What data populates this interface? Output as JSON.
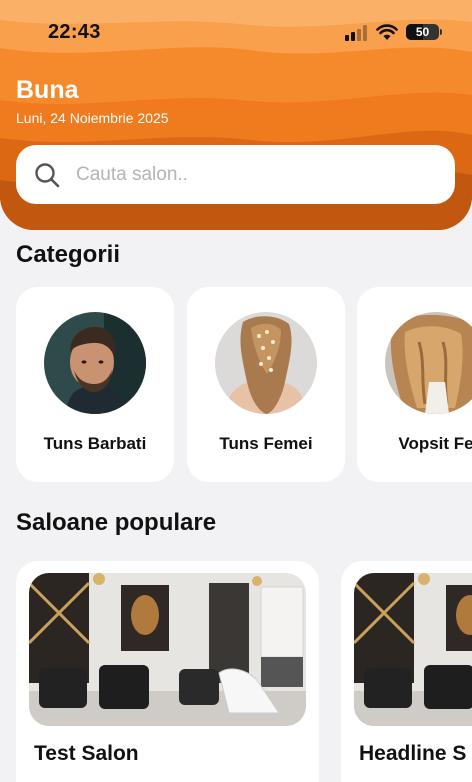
{
  "status_bar": {
    "time": "22:43",
    "battery": "50",
    "battery_level": 0.5
  },
  "header": {
    "greeting": "Buna",
    "date": "Luni, 24 Noiembrie 2025"
  },
  "search": {
    "placeholder": "Cauta salon.."
  },
  "categories": {
    "title": "Categorii",
    "items": [
      {
        "label": "Tuns Barbati",
        "image": "men-haircut-photo"
      },
      {
        "label": "Tuns Femei",
        "image": "women-hairstyle-photo"
      },
      {
        "label": "Vopsit Fe",
        "image": "hair-coloring-photo"
      }
    ]
  },
  "popular": {
    "title": "Saloane populare",
    "items": [
      {
        "name": "Test Salon",
        "image": "salon-interior-photo"
      },
      {
        "name": "Headline S",
        "image": "salon-interior-photo"
      }
    ]
  },
  "colors": {
    "accent": "#f07a1e",
    "accent_dark": "#c2570f",
    "background": "#f2f2f4"
  }
}
